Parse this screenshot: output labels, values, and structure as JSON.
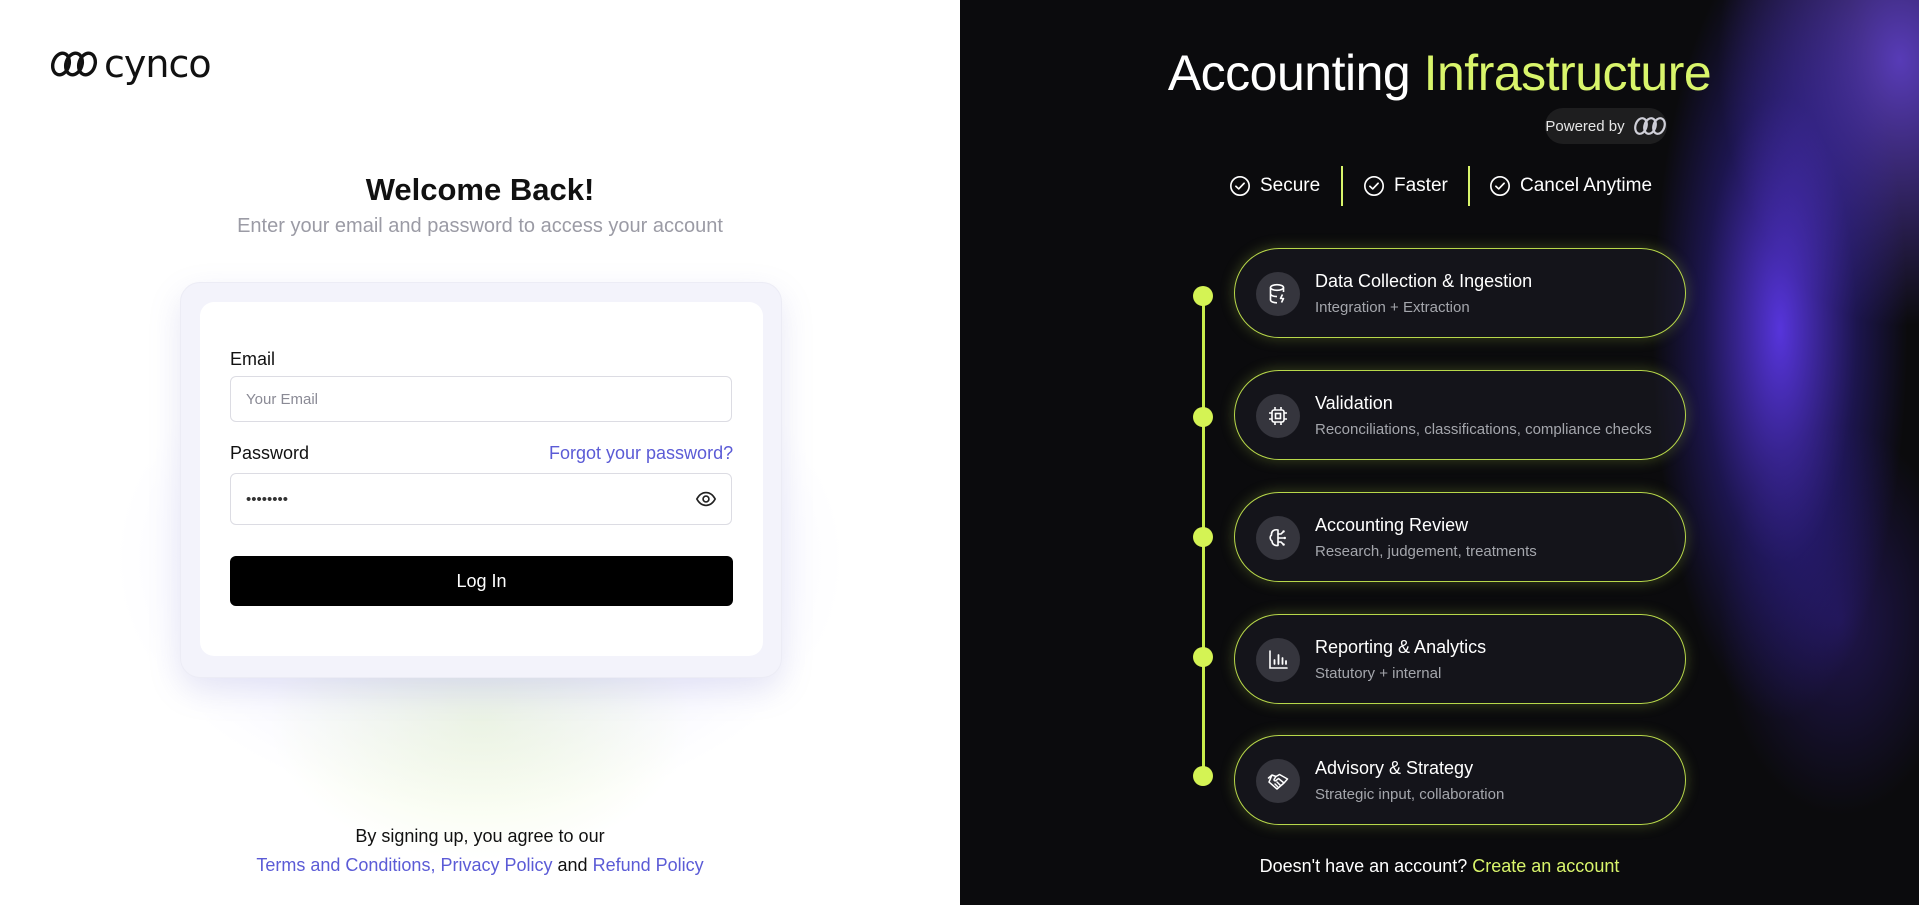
{
  "brand": {
    "name": "cynco"
  },
  "login": {
    "title": "Welcome Back!",
    "subtitle": "Enter your email and password to access your account",
    "email_label": "Email",
    "email_placeholder": "Your Email",
    "password_label": "Password",
    "password_value": "********",
    "forgot_label": "Forgot your password?",
    "login_button": "Log In"
  },
  "terms": {
    "line1": "By signing up, you agree to our",
    "terms_link": "Terms and Conditions,",
    "privacy_link": "Privacy Policy",
    "and": "and",
    "refund_link": "Refund Policy"
  },
  "hero": {
    "title_main": "Accounting",
    "title_accent": "Infrastructure",
    "powered_by": "Powered by",
    "features": [
      "Secure",
      "Faster",
      "Cancel Anytime"
    ],
    "steps": [
      {
        "title": "Data Collection & Ingestion",
        "desc": "Integration + Extraction",
        "icon": "database-icon"
      },
      {
        "title": "Validation",
        "desc": "Reconciliations, classifications, compliance checks",
        "icon": "chip-icon"
      },
      {
        "title": "Accounting Review",
        "desc": "Research, judgement, treatments",
        "icon": "brain-icon"
      },
      {
        "title": "Reporting & Analytics",
        "desc": "Statutory + internal",
        "icon": "bar-chart-icon"
      },
      {
        "title": "Advisory & Strategy",
        "desc": "Strategic input, collaboration",
        "icon": "handshake-icon"
      }
    ],
    "signup_prompt": "Doesn't have an account?",
    "signup_link": "Create an account"
  },
  "colors": {
    "accent_lime": "#d9f56b",
    "link_purple": "#5b5bd6",
    "button_black": "#000000"
  }
}
